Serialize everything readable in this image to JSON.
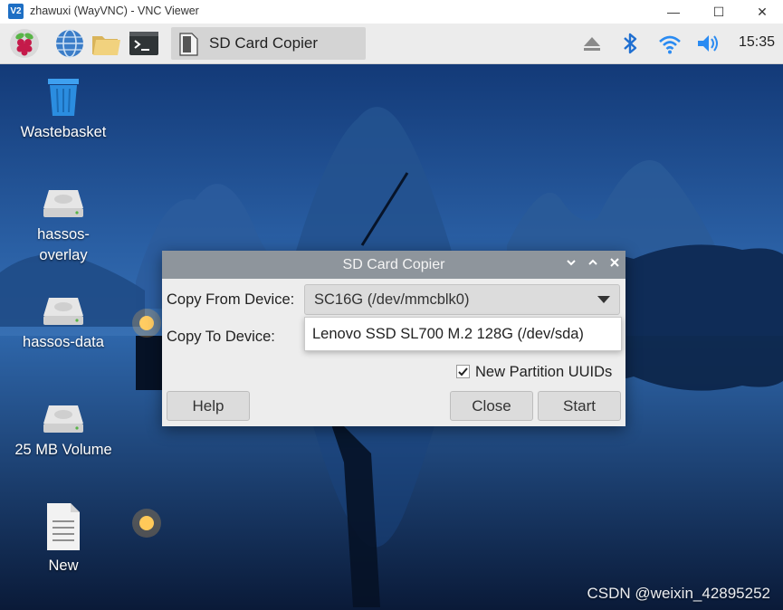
{
  "vnc_window": {
    "logo": "V2",
    "title": "zhawuxi (WayVNC) - VNC Viewer",
    "minimize": "—",
    "maximize": "☐",
    "close": "✕"
  },
  "panel": {
    "launchers": [
      "raspberry-menu-icon",
      "browser-globe-icon",
      "file-manager-folder-icon",
      "terminal-icon"
    ],
    "taskbar_window": "SD Card Copier",
    "tray_icons": [
      "eject-icon",
      "bluetooth-icon",
      "wifi-icon",
      "volume-icon"
    ],
    "clock": "15:35"
  },
  "desktop": {
    "icons": [
      {
        "label": "Wastebasket",
        "icon": "trash-icon"
      },
      {
        "label": "hassos-\noverlay",
        "label_line1": "hassos-",
        "label_line2": "overlay",
        "icon": "drive-icon"
      },
      {
        "label": "hassos-data",
        "icon": "drive-icon"
      },
      {
        "label": "25 MB Volume",
        "icon": "drive-icon"
      },
      {
        "label": "New",
        "icon": "document-icon"
      }
    ]
  },
  "dialog": {
    "title": "SD Card Copier",
    "copy_from_label": "Copy From Device:",
    "copy_from_value": "SC16G  (/dev/mmcblk0)",
    "copy_to_label": "Copy To Device:",
    "copy_to_option": "Lenovo SSD SL700 M.2 128G  (/dev/sda)",
    "new_partition_uuids_label": "New Partition UUIDs",
    "new_partition_uuids_checked": true,
    "help_button": "Help",
    "close_button": "Close",
    "start_button": "Start"
  },
  "watermark": "CSDN @weixin_42895252",
  "colors": {
    "dialog_titlebar": "#8e959c",
    "panel": "#ececec",
    "vnc_logo": "#1e6fc4"
  }
}
